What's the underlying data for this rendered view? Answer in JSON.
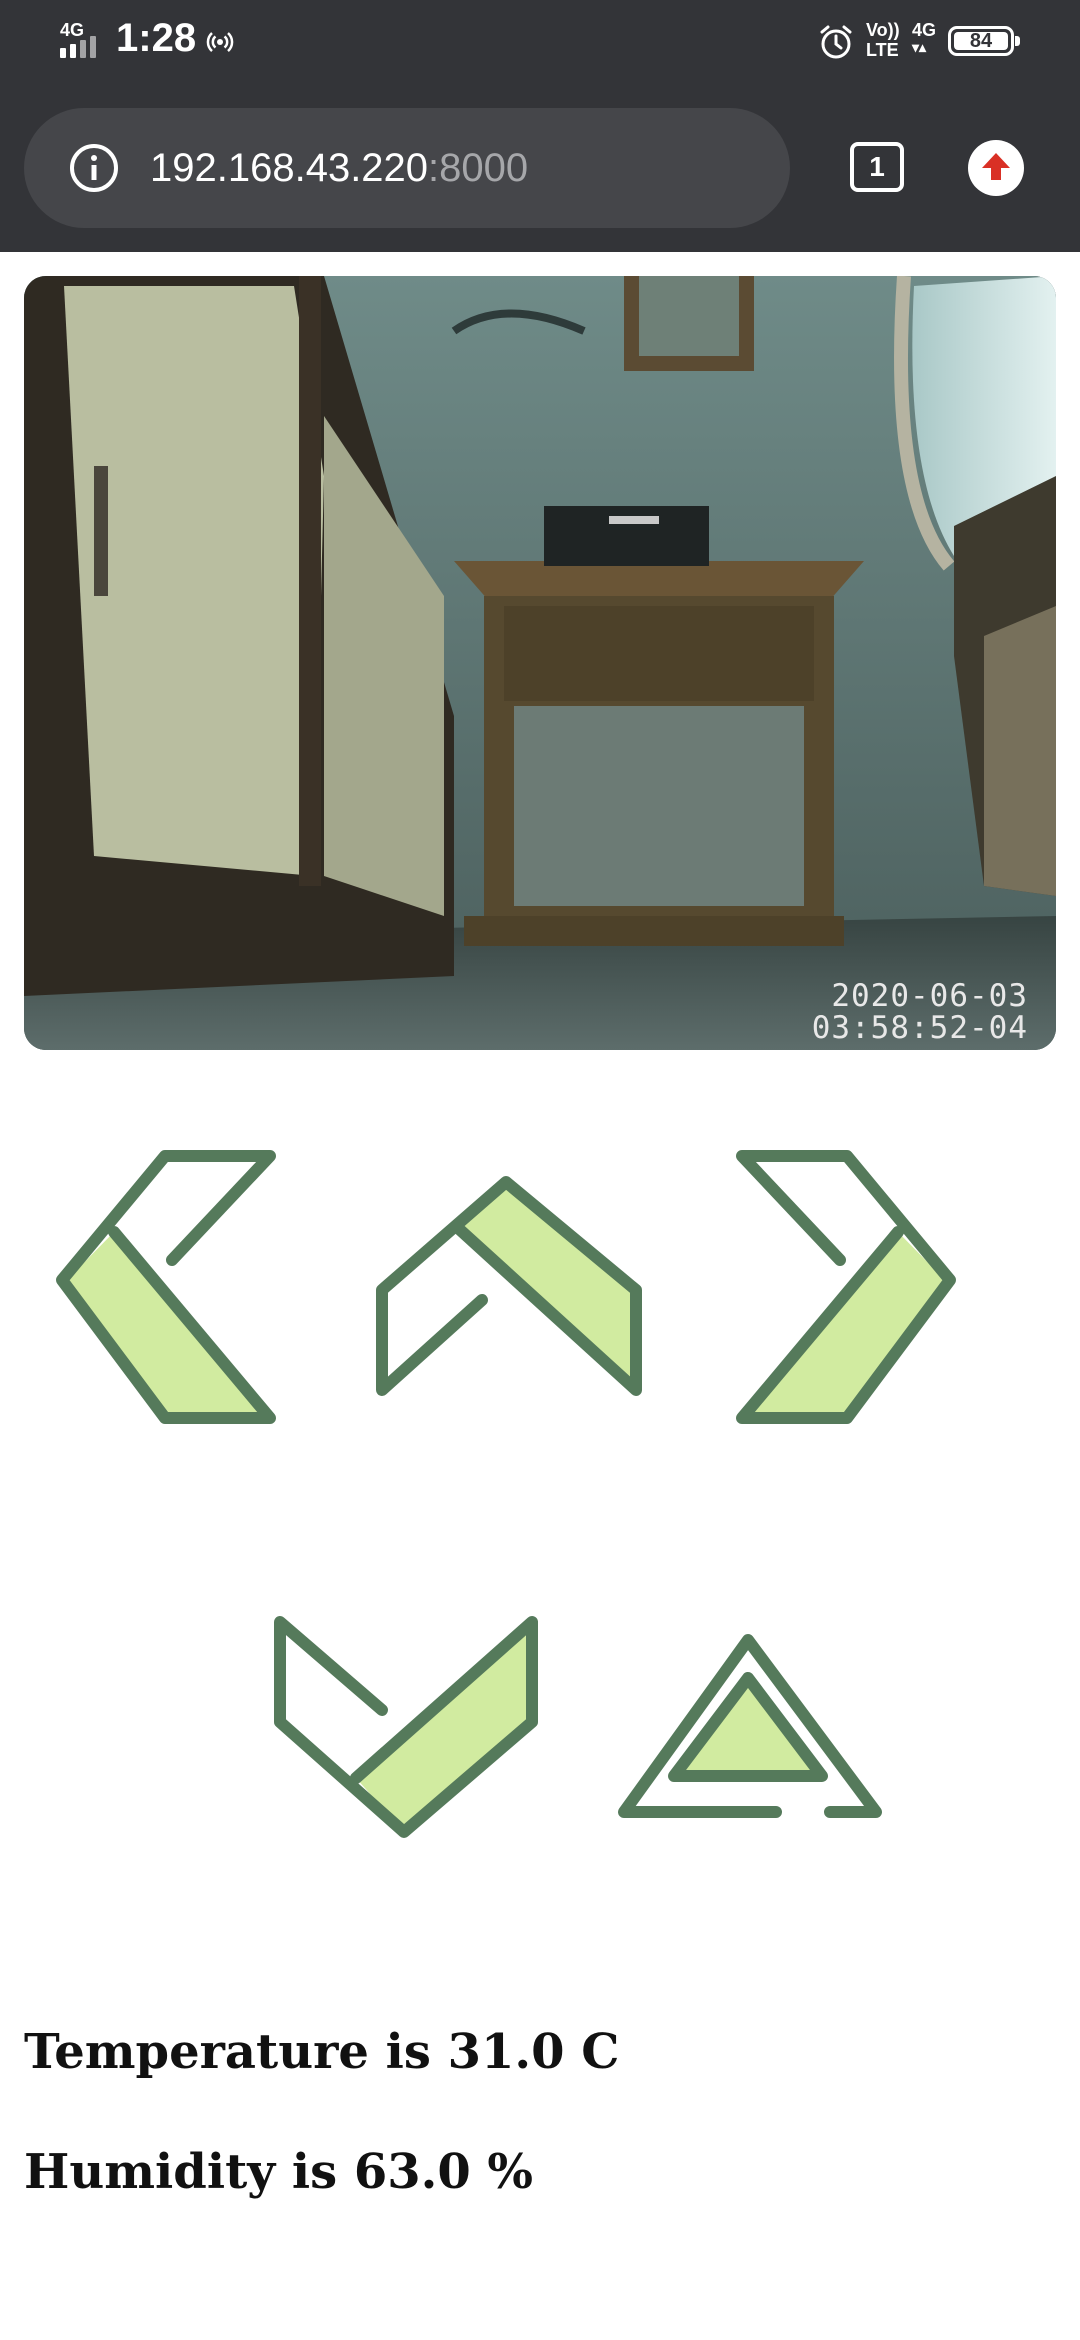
{
  "status_bar": {
    "network": "4G",
    "time": "1:28",
    "volte_top": "Vo))",
    "volte_bottom": "LTE",
    "net_type": "4G",
    "battery": "84",
    "icons": [
      "signal-icon",
      "hotspot-icon",
      "alarm-icon",
      "battery-icon"
    ]
  },
  "browser": {
    "url_host": "192.168.43.220",
    "url_port": ":8000",
    "tab_count": "1",
    "icons": [
      "info-icon",
      "update-icon"
    ],
    "update_color": "#d93025"
  },
  "camera": {
    "timestamp_line1": "2020-06-03",
    "timestamp_line2": "03:58:52-04"
  },
  "controls": {
    "buttons": [
      "left-arrow-icon",
      "forward-arrow-icon",
      "right-arrow-icon",
      "backward-arrow-icon",
      "stop-triangle-icon"
    ],
    "stroke_color": "#557a5b",
    "fill_color": "#d1eba0"
  },
  "sensors": {
    "temperature_text": "Temperature is 31.0 C",
    "humidity_text": "Humidity is 63.0 %"
  }
}
